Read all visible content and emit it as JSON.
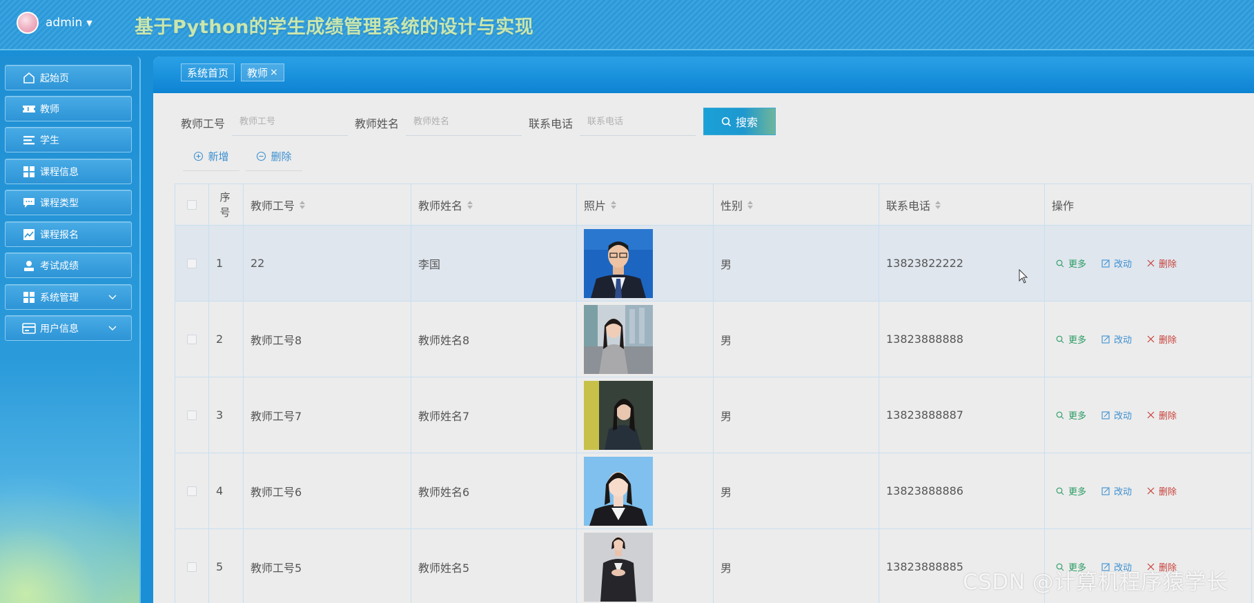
{
  "header": {
    "user_name": "admin",
    "title": "基于Python的学生成绩管理系统的设计与实现"
  },
  "sidebar": {
    "items": [
      {
        "label": "起始页",
        "icon": "home-icon"
      },
      {
        "label": "教师",
        "icon": "ticket-icon"
      },
      {
        "label": "学生",
        "icon": "list-icon"
      },
      {
        "label": "课程信息",
        "icon": "grid-icon"
      },
      {
        "label": "课程类型",
        "icon": "chat-icon"
      },
      {
        "label": "课程报名",
        "icon": "chart-icon"
      },
      {
        "label": "考试成绩",
        "icon": "user-icon"
      },
      {
        "label": "系统管理",
        "icon": "grid-icon",
        "expandable": true
      },
      {
        "label": "用户信息",
        "icon": "card-icon",
        "expandable": true
      }
    ]
  },
  "tabs": [
    {
      "label": "系统首页"
    },
    {
      "label": "教师",
      "closable": true,
      "close": "×"
    }
  ],
  "search": {
    "fields": [
      {
        "label": "教师工号",
        "placeholder": "教师工号"
      },
      {
        "label": "教师姓名",
        "placeholder": "教师姓名"
      },
      {
        "label": "联系电话",
        "placeholder": "联系电话"
      }
    ],
    "button_label": "搜索"
  },
  "actions": {
    "add_label": "新增",
    "delete_label": "删除"
  },
  "table": {
    "headers": {
      "index": "序号",
      "teacher_id": "教师工号",
      "teacher_name": "教师姓名",
      "photo": "照片",
      "gender": "性别",
      "phone": "联系电话",
      "ops": "操作"
    },
    "op_labels": {
      "more": "更多",
      "edit": "改动",
      "delete": "删除"
    },
    "rows": [
      {
        "index": "1",
        "teacher_id": "22",
        "teacher_name": "李国",
        "gender": "男",
        "phone": "13823822222",
        "photo": "male-suit-portrait"
      },
      {
        "index": "2",
        "teacher_id": "教师工号8",
        "teacher_name": "教师姓名8",
        "gender": "男",
        "phone": "13823888888",
        "photo": "female-outdoor-portrait"
      },
      {
        "index": "3",
        "teacher_id": "教师工号7",
        "teacher_name": "教师姓名7",
        "gender": "男",
        "phone": "13823888887",
        "photo": "female-indoor-portrait"
      },
      {
        "index": "4",
        "teacher_id": "教师工号6",
        "teacher_name": "教师姓名6",
        "gender": "男",
        "phone": "13823888886",
        "photo": "female-blue-portrait"
      },
      {
        "index": "5",
        "teacher_id": "教师工号5",
        "teacher_name": "教师姓名5",
        "gender": "男",
        "phone": "13823888885",
        "photo": "female-standing-portrait"
      }
    ]
  },
  "watermark": "CSDN @计算机程序猿学长",
  "colors": {
    "accent": "#1a8fd6",
    "more": "#2b9b64",
    "edit": "#3b8fd0",
    "delete": "#c8413a"
  }
}
